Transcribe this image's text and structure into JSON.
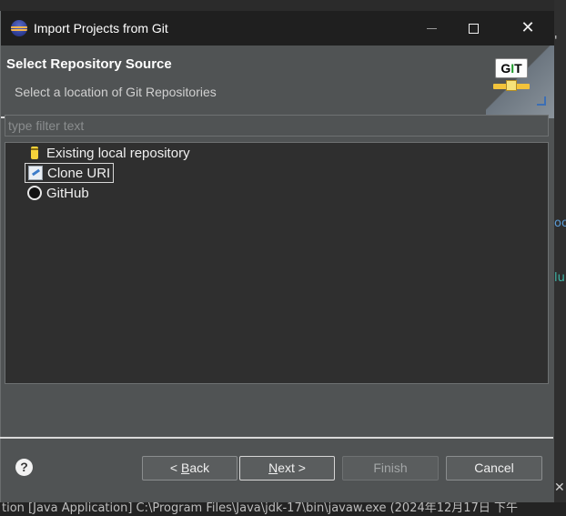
{
  "background": {
    "frag1": "'",
    "frag2": "oo",
    "frag3": "lu",
    "close_glyph": "✕",
    "console_text": "tion [Java Application] C:\\Program Files\\Java\\jdk-17\\bin\\javaw.exe (2024年12月17日 下午"
  },
  "window": {
    "title": "Import Projects from Git",
    "close_glyph": "✕"
  },
  "banner": {
    "title": "Select Repository Source",
    "description": "Select a location of Git Repositories",
    "logo_text": "GIT"
  },
  "filter": {
    "placeholder": "type filter text"
  },
  "tree": {
    "items": [
      {
        "label": "Existing local repository",
        "icon": "repository-icon"
      },
      {
        "label": "Clone URI",
        "icon": "clone-uri-icon",
        "selected": true
      },
      {
        "label": "GitHub",
        "icon": "github-icon"
      }
    ]
  },
  "buttons": {
    "help": "?",
    "back_prefix": "< ",
    "back_mnemonic": "B",
    "back_rest": "ack",
    "next_mnemonic": "N",
    "next_rest": "ext >",
    "finish": "Finish",
    "cancel": "Cancel"
  }
}
